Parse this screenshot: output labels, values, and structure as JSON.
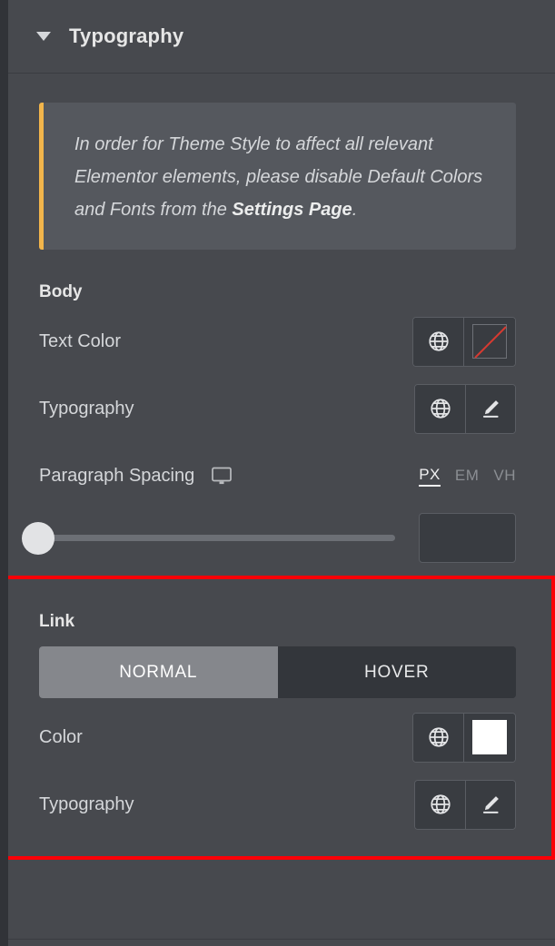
{
  "panel": {
    "header": {
      "title": "Typography",
      "collapse_icon": "chevron-down-icon"
    },
    "notice": {
      "text_part1": "In order for Theme Style to affect all relevant Elementor elements, please disable Default Colors and Fonts from the ",
      "link_text": "Settings Page",
      "text_part2": "."
    },
    "body_section": {
      "label": "Body",
      "text_color": {
        "label": "Text Color",
        "globe_icon": "globe-icon",
        "swatch_value": "",
        "swatch_empty": true
      },
      "typography": {
        "label": "Typography",
        "globe_icon": "globe-icon",
        "edit_icon": "pencil-icon"
      },
      "paragraph_spacing": {
        "label": "Paragraph Spacing",
        "device_icon": "desktop-icon",
        "units": [
          "PX",
          "EM",
          "VH"
        ],
        "active_unit": "PX",
        "slider_value": "",
        "input_value": "",
        "input_placeholder": ""
      }
    },
    "link_section": {
      "label": "Link",
      "highlight_color": "#fb0007",
      "states": [
        "NORMAL",
        "HOVER"
      ],
      "active_state": "NORMAL",
      "color": {
        "label": "Color",
        "globe_icon": "globe-icon",
        "swatch_value": "#FFFFFF",
        "swatch_empty": false
      },
      "typography": {
        "label": "Typography",
        "globe_icon": "globe-icon",
        "edit_icon": "pencil-icon"
      }
    }
  }
}
